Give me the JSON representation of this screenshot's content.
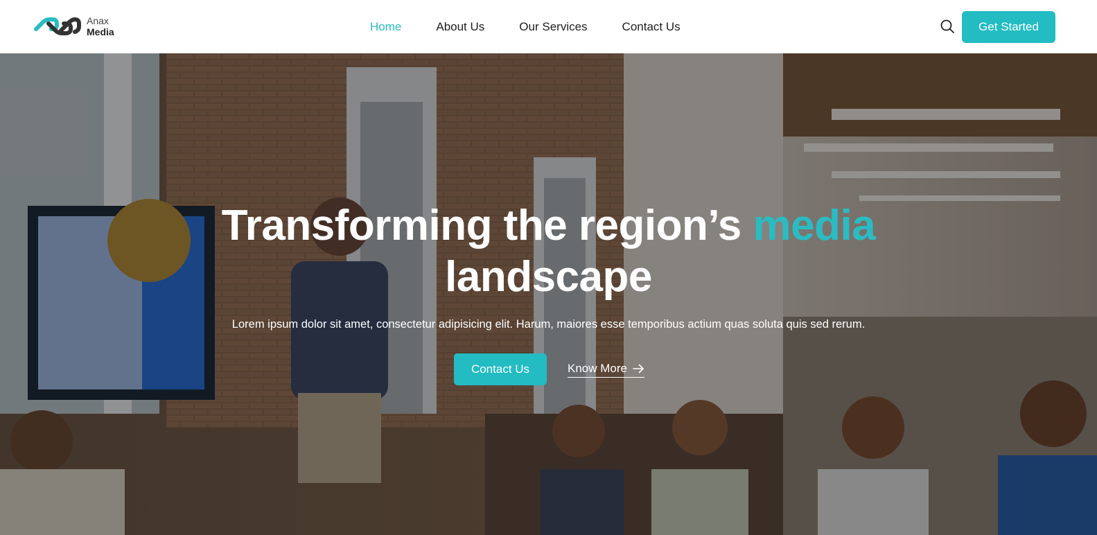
{
  "brand": {
    "line1": "Anax",
    "line2": "Media",
    "logo_icon": "infinity-link-icon",
    "accent_color": "#22bcc2"
  },
  "nav": {
    "items": [
      {
        "label": "Home",
        "active": true
      },
      {
        "label": "About Us",
        "active": false
      },
      {
        "label": "Our Services",
        "active": false
      },
      {
        "label": "Contact Us",
        "active": false
      }
    ]
  },
  "header": {
    "search_icon": "search-icon",
    "cta_label": "Get Started"
  },
  "hero": {
    "title_part1": "Transforming the region’s ",
    "title_accent": "media",
    "title_part2": "landscape",
    "subtitle": "Lorem ipsum dolor sit amet, consectetur adipisicing elit. Harum, maiores esse temporibus actium quas soluta quis sed rerum.",
    "primary_button": "Contact Us",
    "secondary_button": "Know More",
    "secondary_icon": "arrow-right-icon",
    "background": "office-presentation-photo"
  }
}
